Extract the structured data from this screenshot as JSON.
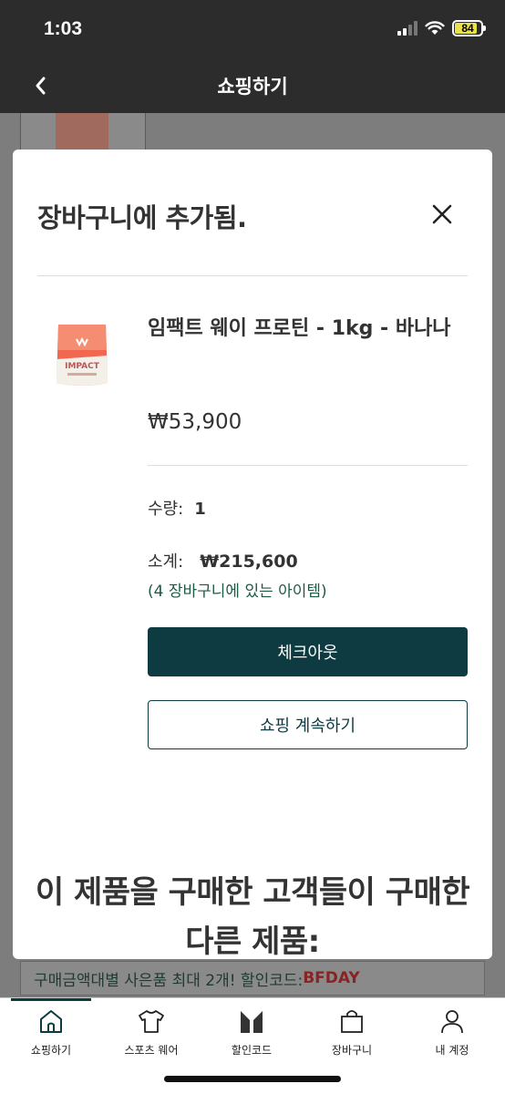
{
  "status_bar": {
    "time": "1:03",
    "battery": "84",
    "battery_level": 0.84
  },
  "nav": {
    "back_icon": "chevron-left-icon",
    "title": "쇼핑하기"
  },
  "modal": {
    "title": "장바구니에 추가됨.",
    "close_icon": "close-icon",
    "product": {
      "name": "임팩트 웨이 프로틴 - 1kg - 바나나",
      "price": "₩53,900",
      "image_icon": "protein-bag-icon"
    },
    "quantity_label": "수량:",
    "quantity_value": "1",
    "subtotal_label": "소계:",
    "subtotal_value": "₩215,600",
    "cart_count_text": "(4 장바구니에 있는 아이템)",
    "checkout_label": "체크아웃",
    "continue_label": "쇼핑 계속하기",
    "upsell_title": "이 제품을 구매한 고객들이 구매한 다른 제품:"
  },
  "promo_banner": {
    "text": "구매금액대별 사은품 최대 2개! 할인코드:",
    "code": "BFDAY"
  },
  "tabbar": {
    "active": "쇼핑하기",
    "items": [
      {
        "label": "쇼핑하기",
        "icon": "home-icon"
      },
      {
        "label": "스포츠 웨어",
        "icon": "tshirt-icon"
      },
      {
        "label": "할인코드",
        "icon": "brand-logo-icon"
      },
      {
        "label": "장바구니",
        "icon": "shopping-bag-icon"
      },
      {
        "label": "내 계정",
        "icon": "user-icon"
      }
    ]
  },
  "colors": {
    "brand_dark": "#0e3b41",
    "accent_green": "#1d5a46",
    "promo_code_red": "#8a2323"
  }
}
